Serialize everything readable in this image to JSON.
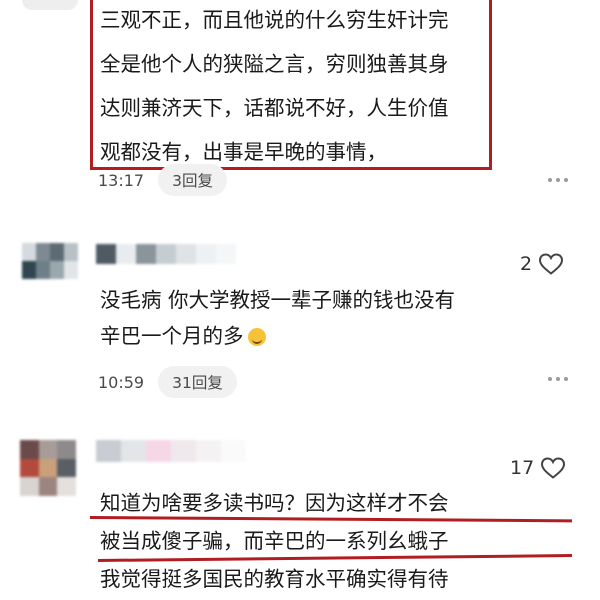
{
  "comments": [
    {
      "text": "三观不正，而且他说的什么穷生奸计完\n全是他个人的狭隘之言，穷则独善其身\n达则兼济天下，话都说不好，人生价值\n观都没有，出事是早晚的事情，",
      "time": "13:17",
      "replies": "3回复",
      "highlight_color": "#b11e22"
    },
    {
      "likes": "2",
      "lines": [
        "没毛病 你大学教授一辈子赚的钱也没有",
        "辛巴一个月的多"
      ],
      "emoji": "face-emoji",
      "time": "10:59",
      "replies": "31回复"
    },
    {
      "likes": "17",
      "lines": [
        "知道为啥要多读书吗？因为这样才不会",
        "被当成傻子骗，而辛巴的一系列幺蛾子",
        "我觉得挺多国民的教育水平确实得有待"
      ],
      "underline_color": "#b11e22"
    }
  ],
  "icons": {
    "like": "heart-outline-icon",
    "more": "more-dots-icon"
  }
}
